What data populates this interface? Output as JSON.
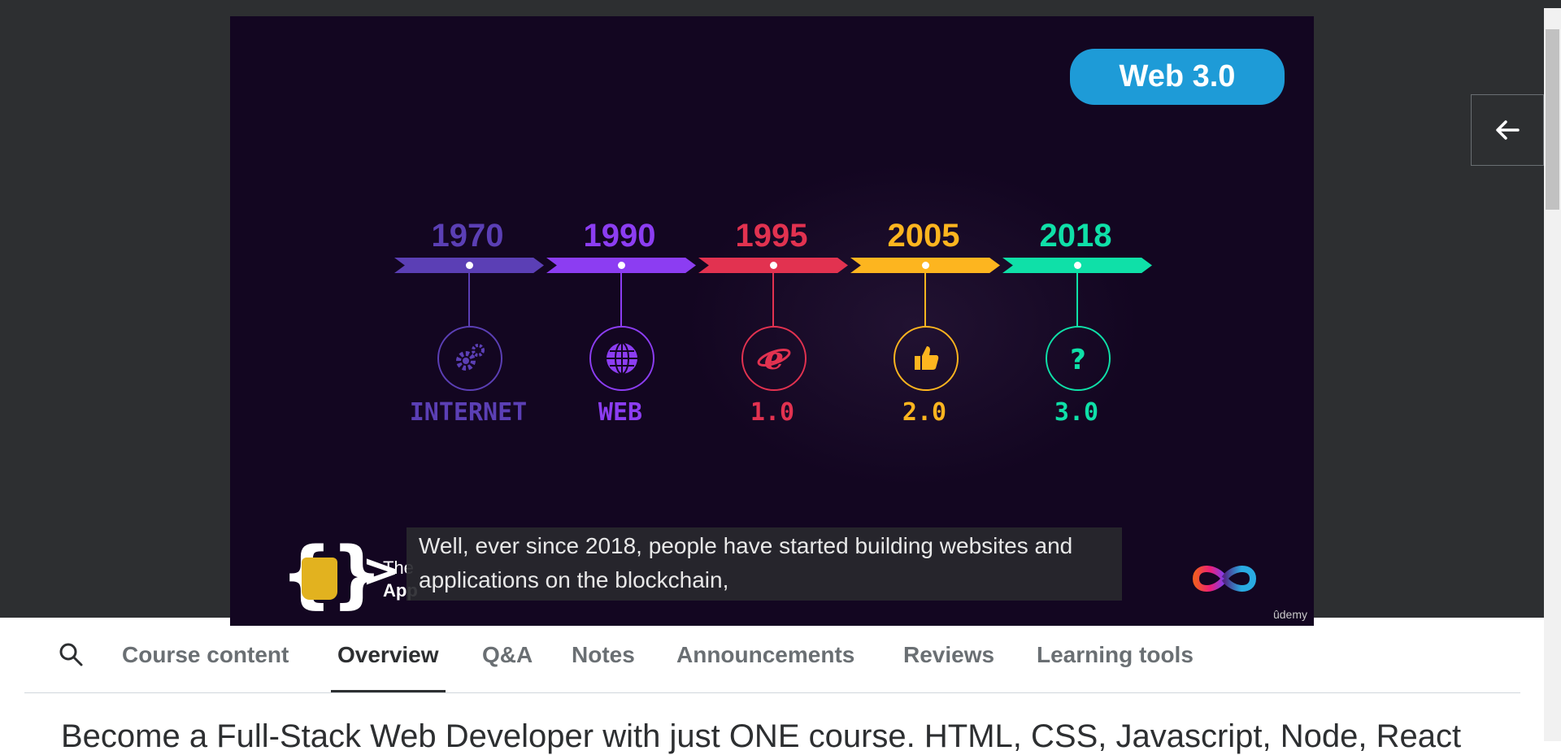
{
  "player": {
    "badge": "Web 3.0",
    "timeline": [
      {
        "year": "1970",
        "era": "INTERNET",
        "icon": "gears-icon",
        "color": "#5b3fb5"
      },
      {
        "year": "1990",
        "era": "WEB",
        "icon": "globe-icon",
        "color": "#8c3df2"
      },
      {
        "year": "1995",
        "era": "1.0",
        "icon": "internet-explorer-icon",
        "color": "#e23250"
      },
      {
        "year": "2005",
        "era": "2.0",
        "icon": "thumbs-up-icon",
        "color": "#fdb51f"
      },
      {
        "year": "2018",
        "era": "3.0",
        "icon": "question-mark-icon",
        "color": "#0fe0a8"
      }
    ],
    "caption_line1": "Well, ever since 2018, people have started building websites and",
    "caption_line2": "applications on the blockchain,",
    "brand_line1": "The",
    "brand_line2": "App",
    "watermark": "ûdemy",
    "background_color": "#130621"
  },
  "tabs": [
    {
      "label": "Course content",
      "active": false
    },
    {
      "label": "Overview",
      "active": true
    },
    {
      "label": "Q&A",
      "active": false
    },
    {
      "label": "Notes",
      "active": false
    },
    {
      "label": "Announcements",
      "active": false
    },
    {
      "label": "Reviews",
      "active": false
    },
    {
      "label": "Learning tools",
      "active": false
    }
  ],
  "course_title": "Become a Full-Stack Web Developer with just ONE course. HTML, CSS, Javascript, Node, React"
}
